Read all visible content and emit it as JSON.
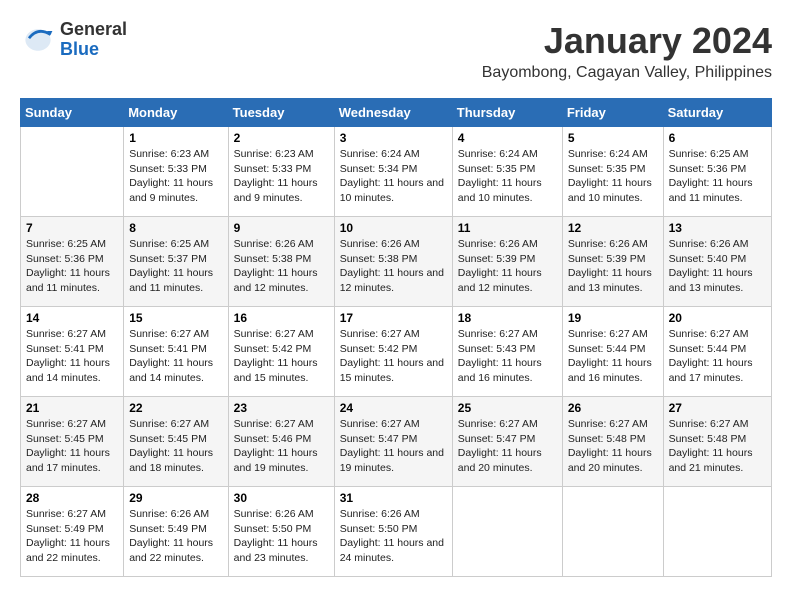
{
  "header": {
    "logo_general": "General",
    "logo_blue": "Blue",
    "month_title": "January 2024",
    "location": "Bayombong, Cagayan Valley, Philippines"
  },
  "days_of_week": [
    "Sunday",
    "Monday",
    "Tuesday",
    "Wednesday",
    "Thursday",
    "Friday",
    "Saturday"
  ],
  "weeks": [
    [
      {
        "day": "",
        "sunrise": "",
        "sunset": "",
        "daylight": ""
      },
      {
        "day": "1",
        "sunrise": "Sunrise: 6:23 AM",
        "sunset": "Sunset: 5:33 PM",
        "daylight": "Daylight: 11 hours and 9 minutes."
      },
      {
        "day": "2",
        "sunrise": "Sunrise: 6:23 AM",
        "sunset": "Sunset: 5:33 PM",
        "daylight": "Daylight: 11 hours and 9 minutes."
      },
      {
        "day": "3",
        "sunrise": "Sunrise: 6:24 AM",
        "sunset": "Sunset: 5:34 PM",
        "daylight": "Daylight: 11 hours and 10 minutes."
      },
      {
        "day": "4",
        "sunrise": "Sunrise: 6:24 AM",
        "sunset": "Sunset: 5:35 PM",
        "daylight": "Daylight: 11 hours and 10 minutes."
      },
      {
        "day": "5",
        "sunrise": "Sunrise: 6:24 AM",
        "sunset": "Sunset: 5:35 PM",
        "daylight": "Daylight: 11 hours and 10 minutes."
      },
      {
        "day": "6",
        "sunrise": "Sunrise: 6:25 AM",
        "sunset": "Sunset: 5:36 PM",
        "daylight": "Daylight: 11 hours and 11 minutes."
      }
    ],
    [
      {
        "day": "7",
        "sunrise": "Sunrise: 6:25 AM",
        "sunset": "Sunset: 5:36 PM",
        "daylight": "Daylight: 11 hours and 11 minutes."
      },
      {
        "day": "8",
        "sunrise": "Sunrise: 6:25 AM",
        "sunset": "Sunset: 5:37 PM",
        "daylight": "Daylight: 11 hours and 11 minutes."
      },
      {
        "day": "9",
        "sunrise": "Sunrise: 6:26 AM",
        "sunset": "Sunset: 5:38 PM",
        "daylight": "Daylight: 11 hours and 12 minutes."
      },
      {
        "day": "10",
        "sunrise": "Sunrise: 6:26 AM",
        "sunset": "Sunset: 5:38 PM",
        "daylight": "Daylight: 11 hours and 12 minutes."
      },
      {
        "day": "11",
        "sunrise": "Sunrise: 6:26 AM",
        "sunset": "Sunset: 5:39 PM",
        "daylight": "Daylight: 11 hours and 12 minutes."
      },
      {
        "day": "12",
        "sunrise": "Sunrise: 6:26 AM",
        "sunset": "Sunset: 5:39 PM",
        "daylight": "Daylight: 11 hours and 13 minutes."
      },
      {
        "day": "13",
        "sunrise": "Sunrise: 6:26 AM",
        "sunset": "Sunset: 5:40 PM",
        "daylight": "Daylight: 11 hours and 13 minutes."
      }
    ],
    [
      {
        "day": "14",
        "sunrise": "Sunrise: 6:27 AM",
        "sunset": "Sunset: 5:41 PM",
        "daylight": "Daylight: 11 hours and 14 minutes."
      },
      {
        "day": "15",
        "sunrise": "Sunrise: 6:27 AM",
        "sunset": "Sunset: 5:41 PM",
        "daylight": "Daylight: 11 hours and 14 minutes."
      },
      {
        "day": "16",
        "sunrise": "Sunrise: 6:27 AM",
        "sunset": "Sunset: 5:42 PM",
        "daylight": "Daylight: 11 hours and 15 minutes."
      },
      {
        "day": "17",
        "sunrise": "Sunrise: 6:27 AM",
        "sunset": "Sunset: 5:42 PM",
        "daylight": "Daylight: 11 hours and 15 minutes."
      },
      {
        "day": "18",
        "sunrise": "Sunrise: 6:27 AM",
        "sunset": "Sunset: 5:43 PM",
        "daylight": "Daylight: 11 hours and 16 minutes."
      },
      {
        "day": "19",
        "sunrise": "Sunrise: 6:27 AM",
        "sunset": "Sunset: 5:44 PM",
        "daylight": "Daylight: 11 hours and 16 minutes."
      },
      {
        "day": "20",
        "sunrise": "Sunrise: 6:27 AM",
        "sunset": "Sunset: 5:44 PM",
        "daylight": "Daylight: 11 hours and 17 minutes."
      }
    ],
    [
      {
        "day": "21",
        "sunrise": "Sunrise: 6:27 AM",
        "sunset": "Sunset: 5:45 PM",
        "daylight": "Daylight: 11 hours and 17 minutes."
      },
      {
        "day": "22",
        "sunrise": "Sunrise: 6:27 AM",
        "sunset": "Sunset: 5:45 PM",
        "daylight": "Daylight: 11 hours and 18 minutes."
      },
      {
        "day": "23",
        "sunrise": "Sunrise: 6:27 AM",
        "sunset": "Sunset: 5:46 PM",
        "daylight": "Daylight: 11 hours and 19 minutes."
      },
      {
        "day": "24",
        "sunrise": "Sunrise: 6:27 AM",
        "sunset": "Sunset: 5:47 PM",
        "daylight": "Daylight: 11 hours and 19 minutes."
      },
      {
        "day": "25",
        "sunrise": "Sunrise: 6:27 AM",
        "sunset": "Sunset: 5:47 PM",
        "daylight": "Daylight: 11 hours and 20 minutes."
      },
      {
        "day": "26",
        "sunrise": "Sunrise: 6:27 AM",
        "sunset": "Sunset: 5:48 PM",
        "daylight": "Daylight: 11 hours and 20 minutes."
      },
      {
        "day": "27",
        "sunrise": "Sunrise: 6:27 AM",
        "sunset": "Sunset: 5:48 PM",
        "daylight": "Daylight: 11 hours and 21 minutes."
      }
    ],
    [
      {
        "day": "28",
        "sunrise": "Sunrise: 6:27 AM",
        "sunset": "Sunset: 5:49 PM",
        "daylight": "Daylight: 11 hours and 22 minutes."
      },
      {
        "day": "29",
        "sunrise": "Sunrise: 6:26 AM",
        "sunset": "Sunset: 5:49 PM",
        "daylight": "Daylight: 11 hours and 22 minutes."
      },
      {
        "day": "30",
        "sunrise": "Sunrise: 6:26 AM",
        "sunset": "Sunset: 5:50 PM",
        "daylight": "Daylight: 11 hours and 23 minutes."
      },
      {
        "day": "31",
        "sunrise": "Sunrise: 6:26 AM",
        "sunset": "Sunset: 5:50 PM",
        "daylight": "Daylight: 11 hours and 24 minutes."
      },
      {
        "day": "",
        "sunrise": "",
        "sunset": "",
        "daylight": ""
      },
      {
        "day": "",
        "sunrise": "",
        "sunset": "",
        "daylight": ""
      },
      {
        "day": "",
        "sunrise": "",
        "sunset": "",
        "daylight": ""
      }
    ]
  ]
}
